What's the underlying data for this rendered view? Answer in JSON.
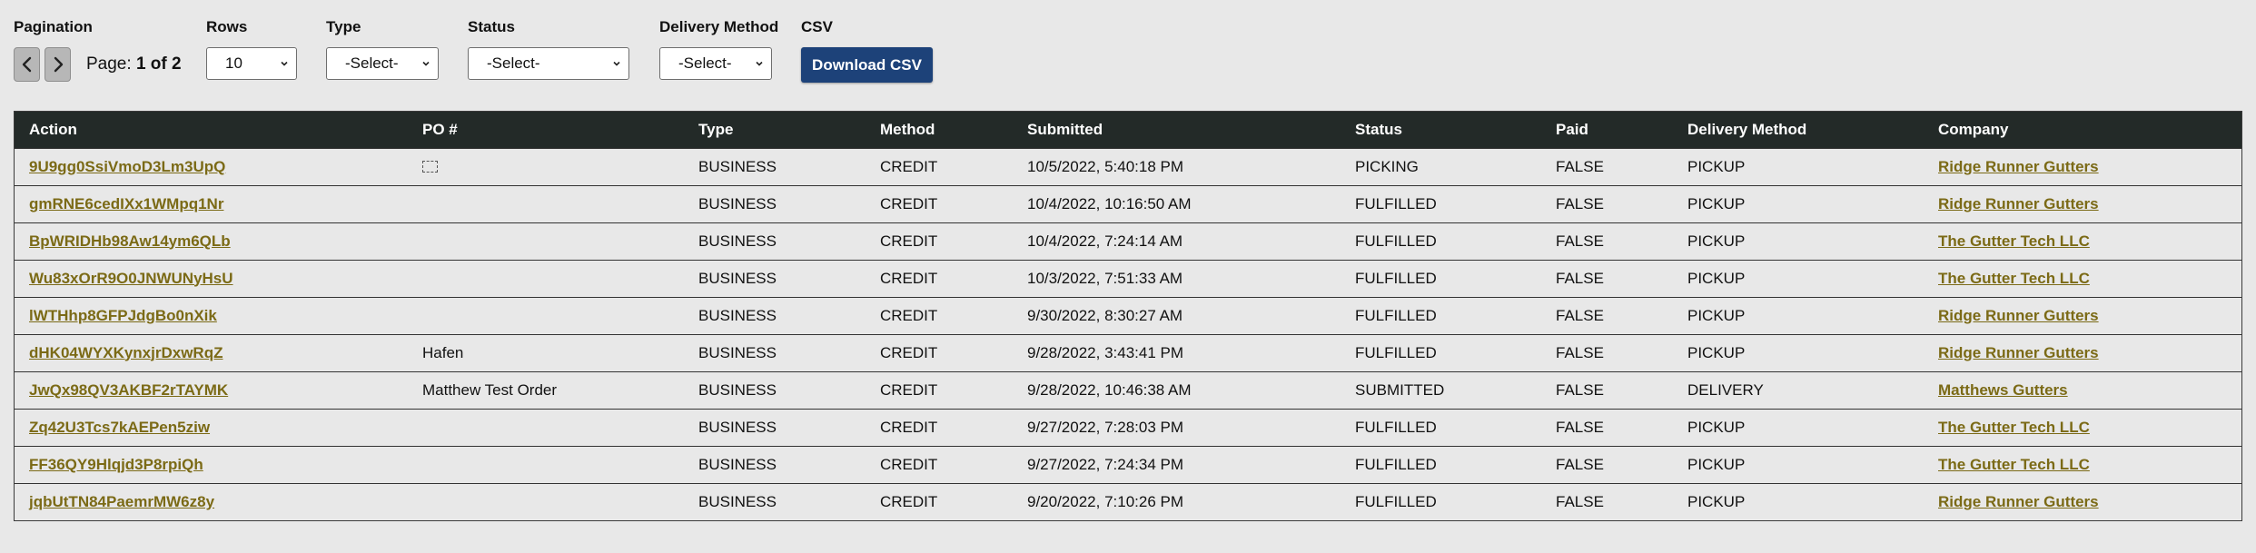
{
  "pagination": {
    "label": "Pagination",
    "prev_icon": "chevron-left-icon",
    "next_icon": "chevron-right-icon",
    "page_prefix": "Page: ",
    "page_value": "1 of 2"
  },
  "filters": {
    "rows": {
      "label": "Rows",
      "value": "10"
    },
    "type": {
      "label": "Type",
      "value": "-Select-"
    },
    "status": {
      "label": "Status",
      "value": "-Select-"
    },
    "delivery_method": {
      "label": "Delivery Method",
      "value": "-Select-"
    }
  },
  "csv": {
    "label": "CSV",
    "button": "Download CSV"
  },
  "colors": {
    "header_bg": "#232a28",
    "link": "#7b6a16",
    "button": "#1d4279",
    "page_bg": "#e8e8e8"
  },
  "table": {
    "columns": [
      "Action",
      "PO #",
      "Type",
      "Method",
      "Submitted",
      "Status",
      "Paid",
      "Delivery Method",
      "Company"
    ],
    "rows": [
      {
        "action": "9U9gg0SsiVmoD3Lm3UpQ",
        "po": "",
        "po_icon": true,
        "type": "BUSINESS",
        "method": "CREDIT",
        "submitted": "10/5/2022, 5:40:18 PM",
        "status": "PICKING",
        "paid": "FALSE",
        "delivery": "PICKUP",
        "company": "Ridge Runner Gutters"
      },
      {
        "action": "gmRNE6cedIXx1WMpq1Nr",
        "po": "",
        "type": "BUSINESS",
        "method": "CREDIT",
        "submitted": "10/4/2022, 10:16:50 AM",
        "status": "FULFILLED",
        "paid": "FALSE",
        "delivery": "PICKUP",
        "company": "Ridge Runner Gutters"
      },
      {
        "action": "BpWRIDHb98Aw14ym6QLb",
        "po": "",
        "type": "BUSINESS",
        "method": "CREDIT",
        "submitted": "10/4/2022, 7:24:14 AM",
        "status": "FULFILLED",
        "paid": "FALSE",
        "delivery": "PICKUP",
        "company": "The Gutter Tech LLC"
      },
      {
        "action": "Wu83xOrR9O0JNWUNyHsU",
        "po": "",
        "type": "BUSINESS",
        "method": "CREDIT",
        "submitted": "10/3/2022, 7:51:33 AM",
        "status": "FULFILLED",
        "paid": "FALSE",
        "delivery": "PICKUP",
        "company": "The Gutter Tech LLC"
      },
      {
        "action": "lWTHhp8GFPJdgBo0nXik",
        "po": "",
        "type": "BUSINESS",
        "method": "CREDIT",
        "submitted": "9/30/2022, 8:30:27 AM",
        "status": "FULFILLED",
        "paid": "FALSE",
        "delivery": "PICKUP",
        "company": "Ridge Runner Gutters"
      },
      {
        "action": "dHK04WYXKynxjrDxwRqZ",
        "po": "Hafen",
        "type": "BUSINESS",
        "method": "CREDIT",
        "submitted": "9/28/2022, 3:43:41 PM",
        "status": "FULFILLED",
        "paid": "FALSE",
        "delivery": "PICKUP",
        "company": "Ridge Runner Gutters"
      },
      {
        "action": "JwQx98QV3AKBF2rTAYMK",
        "po": "Matthew Test Order",
        "type": "BUSINESS",
        "method": "CREDIT",
        "submitted": "9/28/2022, 10:46:38 AM",
        "status": "SUBMITTED",
        "paid": "FALSE",
        "delivery": "DELIVERY",
        "company": "Matthews Gutters"
      },
      {
        "action": "Zq42U3Tcs7kAEPen5ziw",
        "po": "",
        "type": "BUSINESS",
        "method": "CREDIT",
        "submitted": "9/27/2022, 7:28:03 PM",
        "status": "FULFILLED",
        "paid": "FALSE",
        "delivery": "PICKUP",
        "company": "The Gutter Tech LLC"
      },
      {
        "action": "FF36QY9Hlqjd3P8rpiQh",
        "po": "",
        "type": "BUSINESS",
        "method": "CREDIT",
        "submitted": "9/27/2022, 7:24:34 PM",
        "status": "FULFILLED",
        "paid": "FALSE",
        "delivery": "PICKUP",
        "company": "The Gutter Tech LLC"
      },
      {
        "action": "jqbUtTN84PaemrMW6z8y",
        "po": "",
        "type": "BUSINESS",
        "method": "CREDIT",
        "submitted": "9/20/2022, 7:10:26 PM",
        "status": "FULFILLED",
        "paid": "FALSE",
        "delivery": "PICKUP",
        "company": "Ridge Runner Gutters"
      }
    ]
  }
}
